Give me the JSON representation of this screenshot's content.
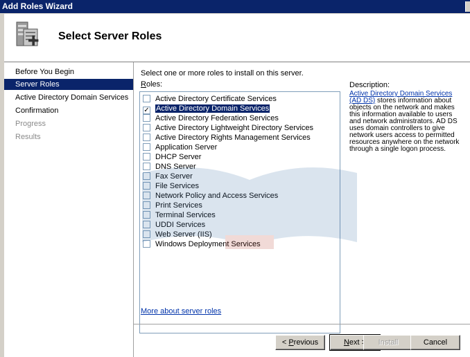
{
  "window": {
    "title": "Add Roles Wizard"
  },
  "header": {
    "title": "Select Server Roles",
    "icon": "server-roles-icon"
  },
  "sidebar": {
    "items": [
      {
        "label": "Before You Begin",
        "state": "normal"
      },
      {
        "label": "Server Roles",
        "state": "active"
      },
      {
        "label": "Active Directory Domain Services",
        "state": "normal"
      },
      {
        "label": "Confirmation",
        "state": "normal"
      },
      {
        "label": "Progress",
        "state": "disabled"
      },
      {
        "label": "Results",
        "state": "disabled"
      }
    ]
  },
  "main": {
    "instruction": "Select one or more roles to install on this server.",
    "roles_label_accel": "R",
    "roles_label_rest": "oles:",
    "roles": [
      {
        "label": "Active Directory Certificate Services",
        "checked": false,
        "selected": false
      },
      {
        "label": "Active Directory Domain Services",
        "checked": true,
        "selected": true
      },
      {
        "label": "Active Directory Federation Services",
        "checked": false,
        "selected": false
      },
      {
        "label": "Active Directory Lightweight Directory Services",
        "checked": false,
        "selected": false
      },
      {
        "label": "Active Directory Rights Management Services",
        "checked": false,
        "selected": false
      },
      {
        "label": "Application Server",
        "checked": false,
        "selected": false
      },
      {
        "label": "DHCP Server",
        "checked": false,
        "selected": false
      },
      {
        "label": "DNS Server",
        "checked": false,
        "selected": false
      },
      {
        "label": "Fax Server",
        "checked": false,
        "selected": false
      },
      {
        "label": "File Services",
        "checked": false,
        "selected": false
      },
      {
        "label": "Network Policy and Access Services",
        "checked": false,
        "selected": false
      },
      {
        "label": "Print Services",
        "checked": false,
        "selected": false
      },
      {
        "label": "Terminal Services",
        "checked": false,
        "selected": false
      },
      {
        "label": "UDDI Services",
        "checked": false,
        "selected": false
      },
      {
        "label": "Web Server (IIS)",
        "checked": false,
        "selected": false
      },
      {
        "label": "Windows Deployment Services",
        "checked": false,
        "selected": false
      }
    ],
    "description_label": "Description:",
    "description_link": "Active Directory Domain Services (AD DS)",
    "description_text": " stores information about objects on the network and makes this information available to users and network administrators. AD DS uses domain controllers to give network users access to permitted resources anywhere on the network through a single logon process.",
    "more_link": "More about server roles"
  },
  "buttons": {
    "previous_accel": "P",
    "previous_rest": "revious",
    "previous_prefix": "< ",
    "next_accel": "N",
    "next_rest": "ext >",
    "install": "Install",
    "cancel": "Cancel"
  },
  "colors": {
    "titlebar": "#0a246a",
    "selection": "#0a246a",
    "link": "#0033aa",
    "chrome": "#d4d0c8"
  }
}
